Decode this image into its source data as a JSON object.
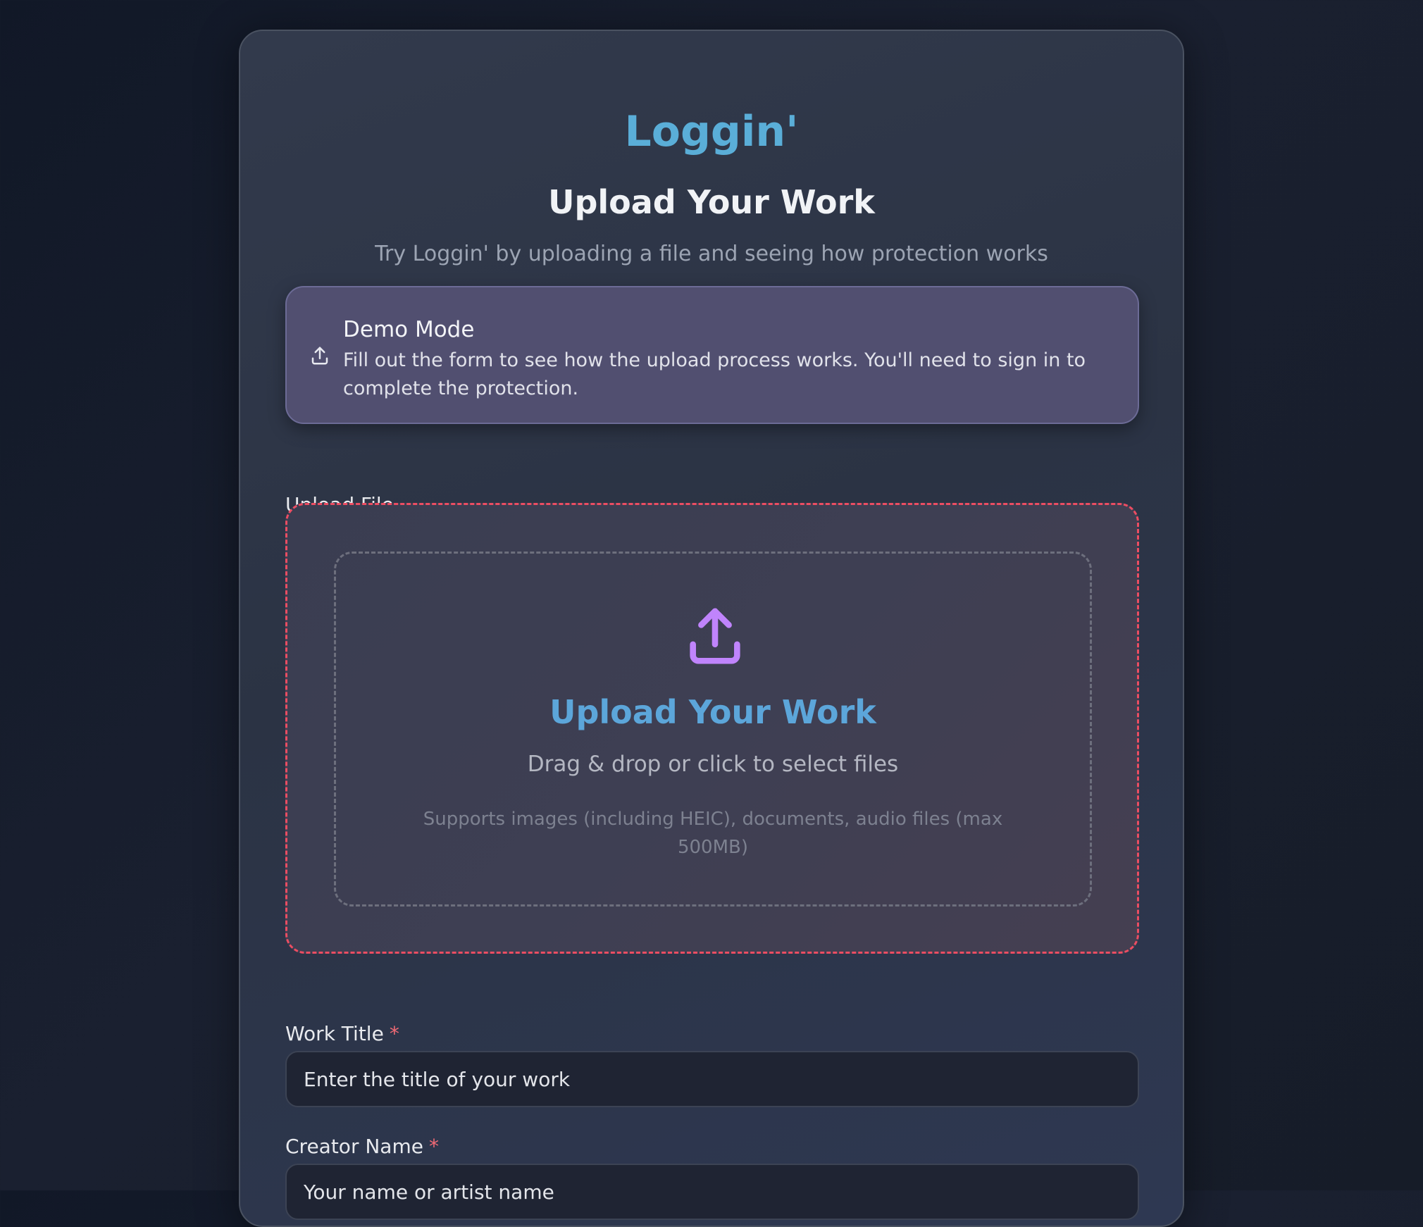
{
  "brand": "Loggin'",
  "header": {
    "title": "Upload Your Work",
    "subtitle": "Try Loggin' by uploading a file and seeing how protection works"
  },
  "notice": {
    "icon": "upload-icon",
    "title": "Demo Mode",
    "text": "Fill out the form to see how the upload process works. You'll need to sign in to complete the protection."
  },
  "upload": {
    "label": "Upload File",
    "icon": "upload-icon",
    "title": "Upload Your Work",
    "instruction": "Drag & drop or click to select files",
    "hint": "Supports images (including HEIC), documents, audio files (max 500MB)"
  },
  "form": {
    "work_title": {
      "label": "Work Title",
      "required_marker": "*",
      "placeholder": "Enter the title of your work",
      "value": ""
    },
    "creator_name": {
      "label": "Creator Name",
      "required_marker": "*",
      "placeholder": "Your name or artist name",
      "value": ""
    }
  },
  "colors": {
    "accent": "#5aaed8",
    "required": "#f06a75",
    "dropzone_border": "#ec4d62",
    "icon": "#c084fc"
  }
}
